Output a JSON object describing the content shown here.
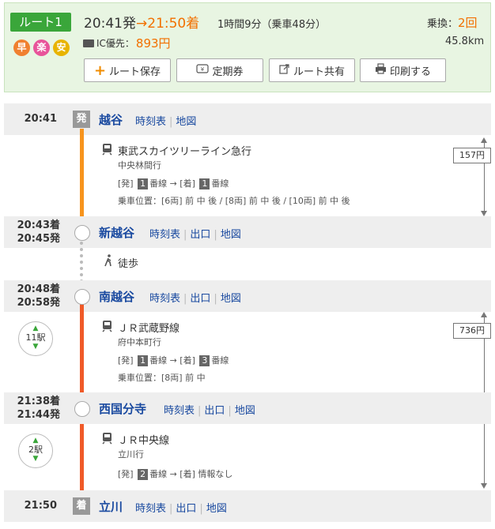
{
  "summary": {
    "route_label": "ルート1",
    "badges": [
      "早",
      "楽",
      "安"
    ],
    "depart_time": "20:41発",
    "arrow": "→",
    "arrive_time": "21:50着",
    "duration": "1時間9分（乗車48分）",
    "transfers_label": "乗換：",
    "transfers_value": "2回",
    "ic_label": "IC優先：",
    "ic_value": "893円",
    "distance": "45.8km"
  },
  "actions": {
    "save": "ルート保存",
    "pass": "定期券",
    "share": "ルート共有",
    "print": "印刷する"
  },
  "links": {
    "timetable": "時刻表",
    "exit": "出口",
    "map": "地図"
  },
  "marks": {
    "depart": "発",
    "arrive": "着"
  },
  "stations": [
    {
      "arr": "",
      "dep": "20:41",
      "name": "越谷"
    },
    {
      "arr": "20:43着",
      "dep": "20:45発",
      "name": "新越谷"
    },
    {
      "arr": "20:48着",
      "dep": "20:58発",
      "name": "南越谷"
    },
    {
      "arr": "21:38着",
      "dep": "21:44発",
      "name": "西国分寺"
    },
    {
      "arr": "",
      "dep": "21:50",
      "name": "立川"
    }
  ],
  "segments": [
    {
      "line": "東武スカイツリーライン急行",
      "direction": "中央林間行",
      "plat_dep_prefix": "[発]",
      "plat_dep": "1",
      "plat_suffix": "番線 → [着]",
      "plat_arr": "1",
      "plat_arr_suffix": "番線",
      "position": "乗車位置：[6両] 前 中 後 / [8両] 前 中 後 / [10両] 前 中 後",
      "fare": "157円"
    },
    {
      "walk": "徒歩"
    },
    {
      "line": "ＪＲ武蔵野線",
      "direction": "府中本町行",
      "plat_dep_prefix": "[発]",
      "plat_dep": "1",
      "plat_suffix": "番線 → [着]",
      "plat_arr": "3",
      "plat_arr_suffix": "番線",
      "position": "乗車位置：[8両] 前 中",
      "stops": "11駅",
      "fare": "736円"
    },
    {
      "line": "ＪＲ中央線",
      "direction": "立川行",
      "plat_dep_prefix": "[発]",
      "plat_dep": "2",
      "plat_text": "番線 → [着] 情報なし",
      "stops": "2駅"
    }
  ],
  "colors": {
    "tobu_line": "#f7941d",
    "jr_line": "#f05a28",
    "walk_line": "#bbbbbb",
    "accent": "#f27000",
    "link": "#1a4aa0"
  }
}
